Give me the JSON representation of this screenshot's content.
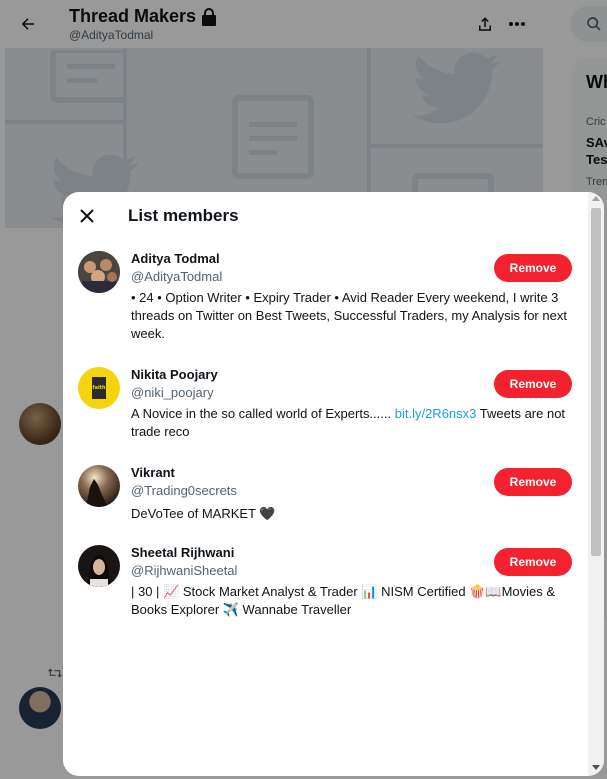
{
  "header": {
    "title": "Thread Makers",
    "handle": "@AdityaTodmal"
  },
  "sidebar_peek": {
    "what": "Wh",
    "category": "Cric",
    "headline": "SAv",
    "headline2": "Tes",
    "trend": "Tren"
  },
  "modal": {
    "title": "List members"
  },
  "members": [
    {
      "name": "Aditya Todmal",
      "handle": "@AdityaTodmal",
      "bio": "• 24 • Option Writer • Expiry Trader • Avid Reader Every weekend, I write 3 threads on Twitter on Best Tweets, Successful Traders, my Analysis for next week.",
      "remove_label": "Remove"
    },
    {
      "name": "Nikita Poojary",
      "handle": "@niki_poojary",
      "bio_pre": "A Novice in the so called world of Experts...... ",
      "bio_link": "bit.ly/2R6nsx3",
      "bio_post": " Tweets are not trade reco",
      "avatar_text": "faith",
      "remove_label": "Remove"
    },
    {
      "name": "Vikrant",
      "handle": "@Trading0secrets",
      "bio": "DeVoTee of MARKET 🖤",
      "remove_label": "Remove"
    },
    {
      "name": "Sheetal Rijhwani",
      "handle": "@RijhwaniSheetal",
      "bio": "| 30 | 📈 Stock Market Analyst & Trader 📊 NISM Certified 🍿📖Movies & Books Explorer ✈️ Wannabe Traveller",
      "remove_label": "Remove"
    }
  ],
  "colors": {
    "remove": "#f4212e",
    "link": "#1d9bf0",
    "muted": "#536471"
  }
}
